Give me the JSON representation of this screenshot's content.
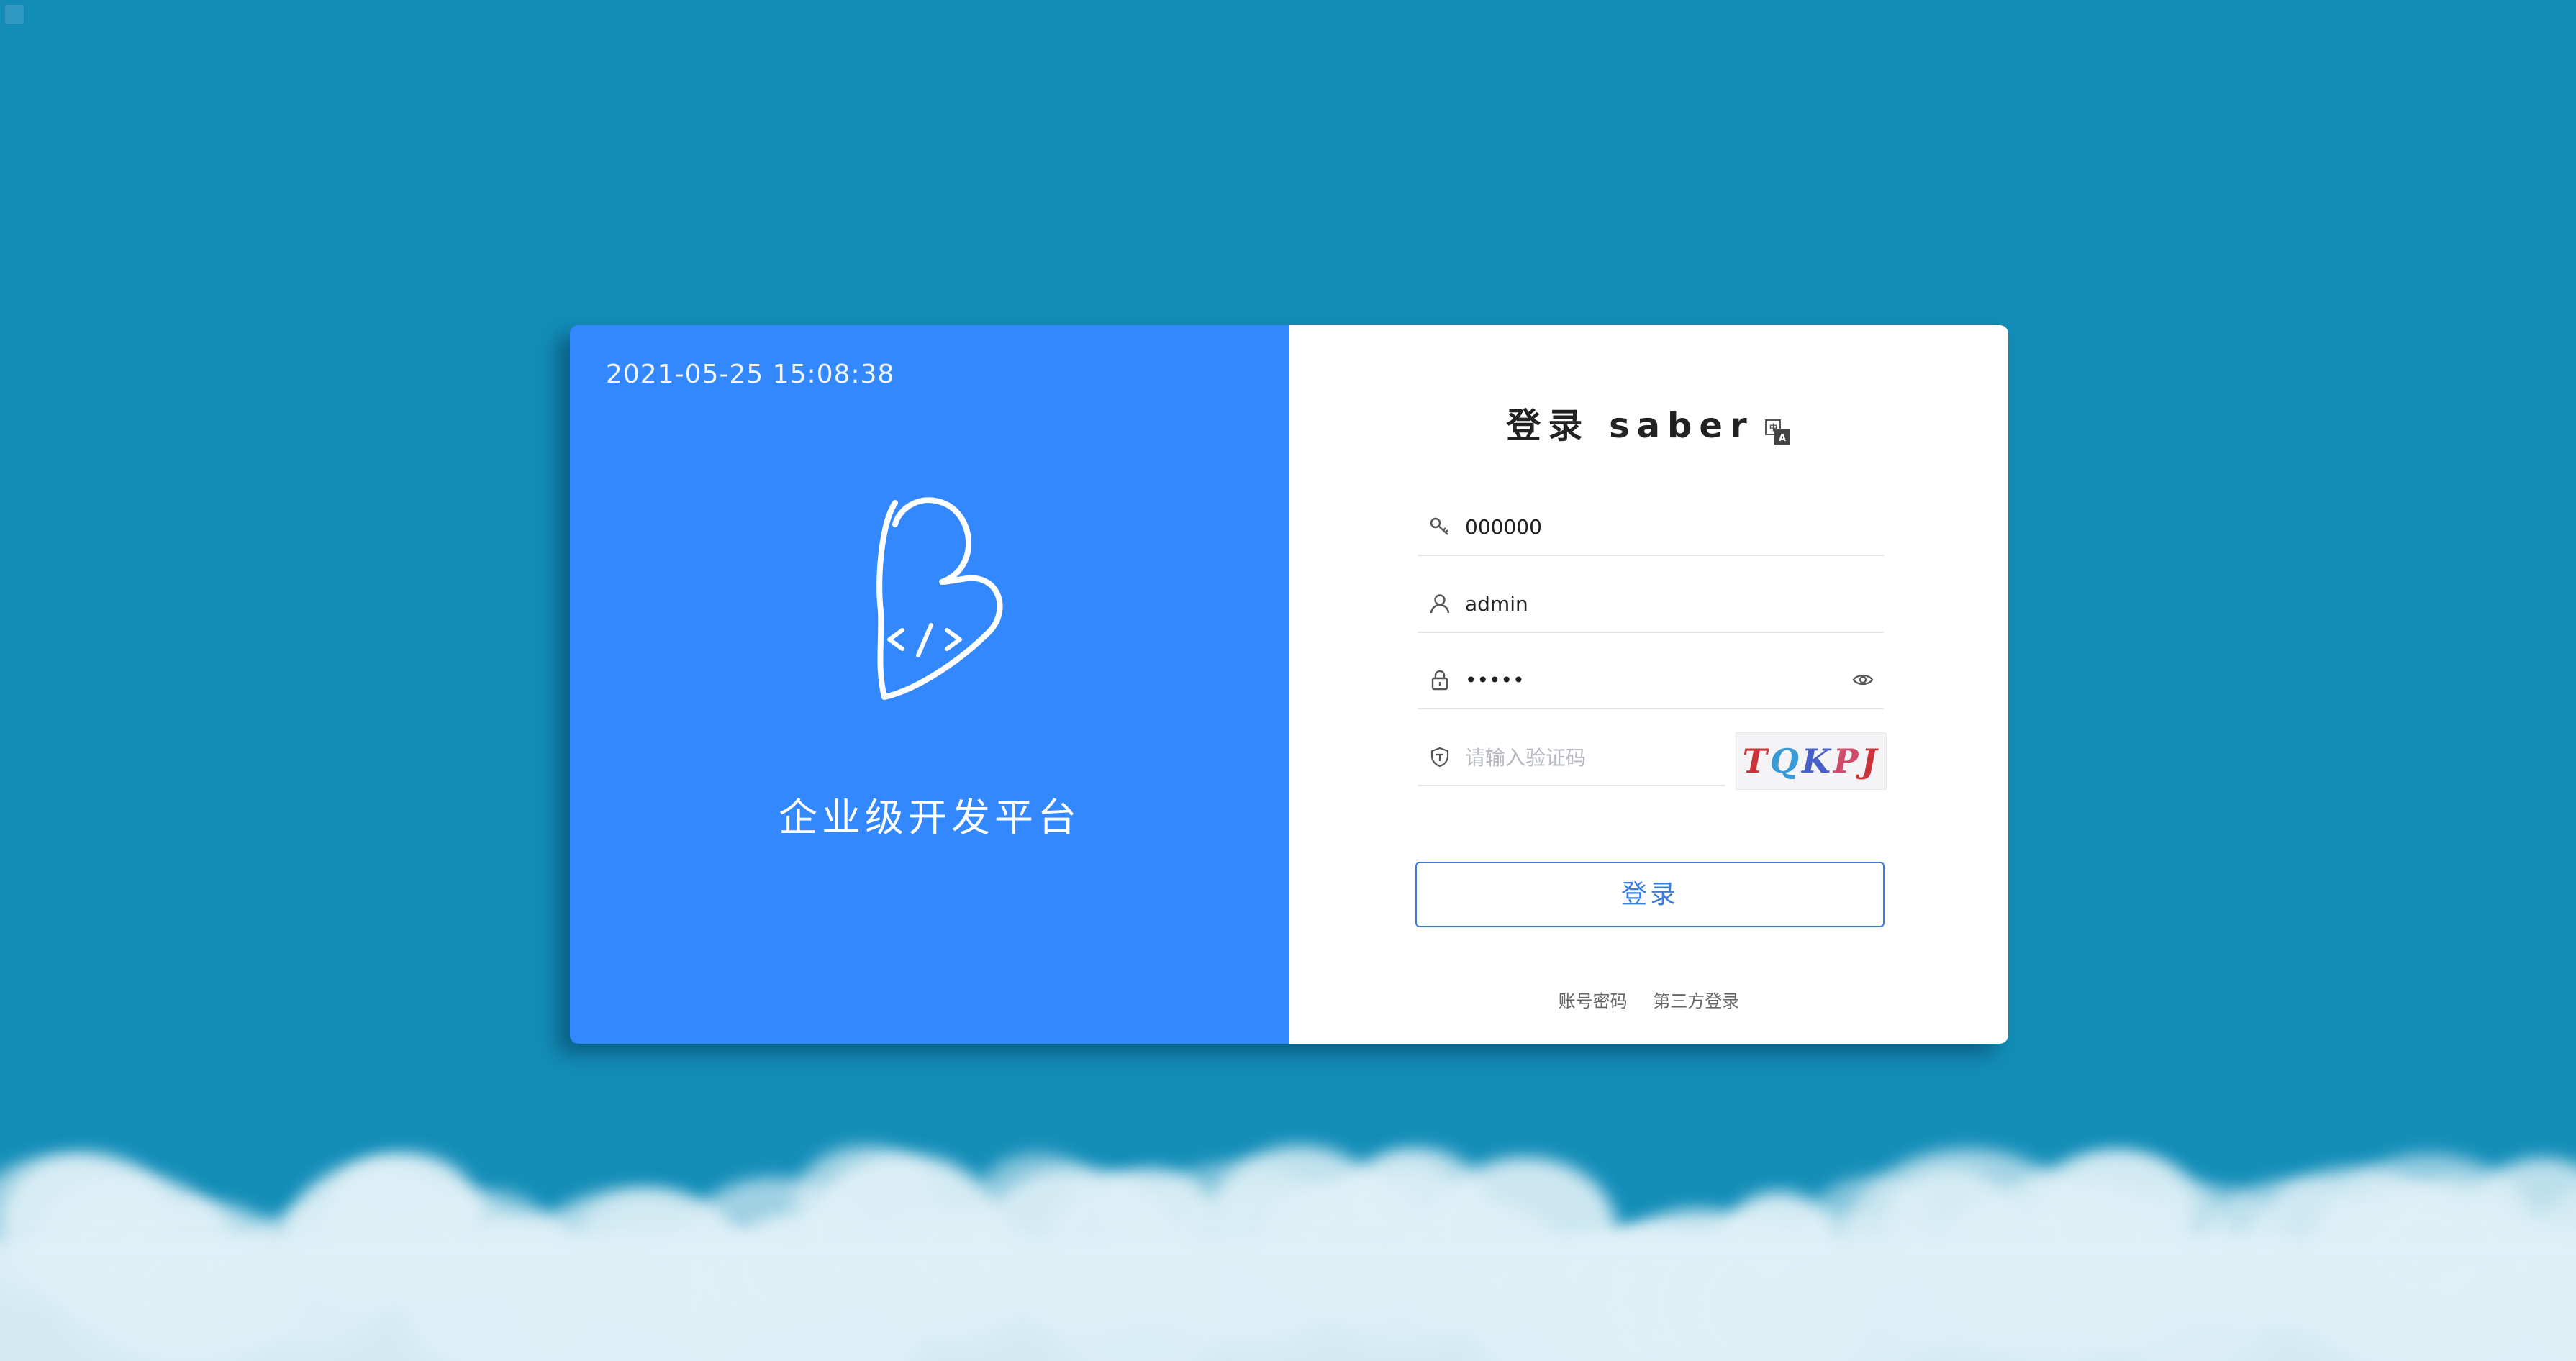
{
  "left": {
    "datetime": "2021-05-25 15:08:38",
    "tagline": "企业级开发平台"
  },
  "login": {
    "title": "登录 saber",
    "tenant_value": "000000",
    "username_value": "admin",
    "password_value": "•••••",
    "captcha_placeholder": "请输入验证码",
    "captcha_text": [
      "T",
      "Q",
      "K",
      "P",
      "J"
    ],
    "submit_label": "登录",
    "link_account": "账号密码",
    "link_third_party": "第三方登录"
  },
  "icons": {
    "tenant": "key-icon",
    "username": "user-icon",
    "password": "lock-icon",
    "password_toggle": "eye-icon",
    "captcha": "shield-icon",
    "language": "translate-icon"
  },
  "colors": {
    "background": "#138db8",
    "left_panel": "#3388fd",
    "accent": "#3a7de0"
  }
}
